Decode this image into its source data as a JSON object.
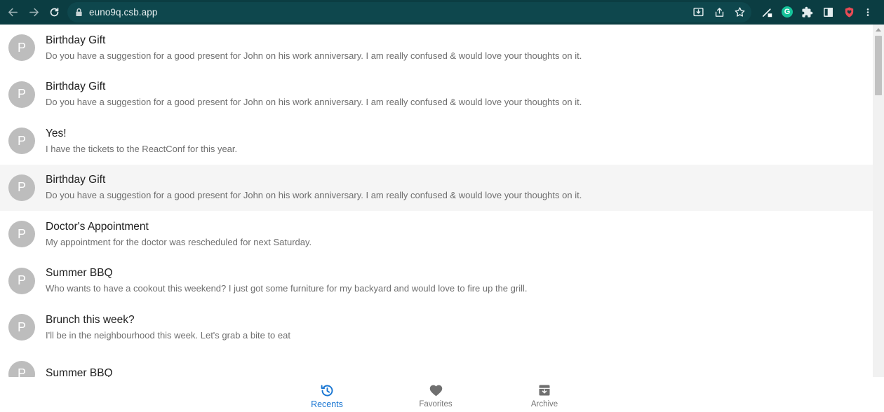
{
  "browser": {
    "url": "euno9q.csb.app",
    "icons": [
      "back-arrow-icon",
      "forward-arrow-icon",
      "reload-icon",
      "lock-icon",
      "install-app-icon",
      "share-icon",
      "bookmark-star-icon",
      "pen-extension-icon",
      "grammarly-icon",
      "extensions-puzzle-icon",
      "side-panel-icon",
      "profile-shield-icon",
      "more-vert-icon"
    ],
    "grammarly_letter": "G"
  },
  "messages": [
    {
      "avatar": "P",
      "title": "Birthday Gift",
      "body": "Do you have a suggestion for a good present for John on his work anniversary. I am really confused & would love your thoughts on it."
    },
    {
      "avatar": "P",
      "title": "Birthday Gift",
      "body": "Do you have a suggestion for a good present for John on his work anniversary. I am really confused & would love your thoughts on it."
    },
    {
      "avatar": "P",
      "title": "Yes!",
      "body": "I have the tickets to the ReactConf for this year."
    },
    {
      "avatar": "P",
      "title": "Birthday Gift",
      "body": "Do you have a suggestion for a good present for John on his work anniversary. I am really confused & would love your thoughts on it."
    },
    {
      "avatar": "P",
      "title": "Doctor's Appointment",
      "body": "My appointment for the doctor was rescheduled for next Saturday."
    },
    {
      "avatar": "P",
      "title": "Summer BBQ",
      "body": "Who wants to have a cookout this weekend? I just got some furniture for my backyard and would love to fire up the grill."
    },
    {
      "avatar": "P",
      "title": "Brunch this week?",
      "body": "I'll be in the neighbourhood this week. Let's grab a bite to eat"
    },
    {
      "avatar": "P",
      "title": "Summer BBQ",
      "body": ""
    }
  ],
  "bottom_nav": {
    "recents": {
      "label": "Recents",
      "icon": "history-icon"
    },
    "favorites": {
      "label": "Favorites",
      "icon": "heart-icon"
    },
    "archive": {
      "label": "Archive",
      "icon": "archive-icon"
    },
    "active_color": "#1976d2"
  }
}
